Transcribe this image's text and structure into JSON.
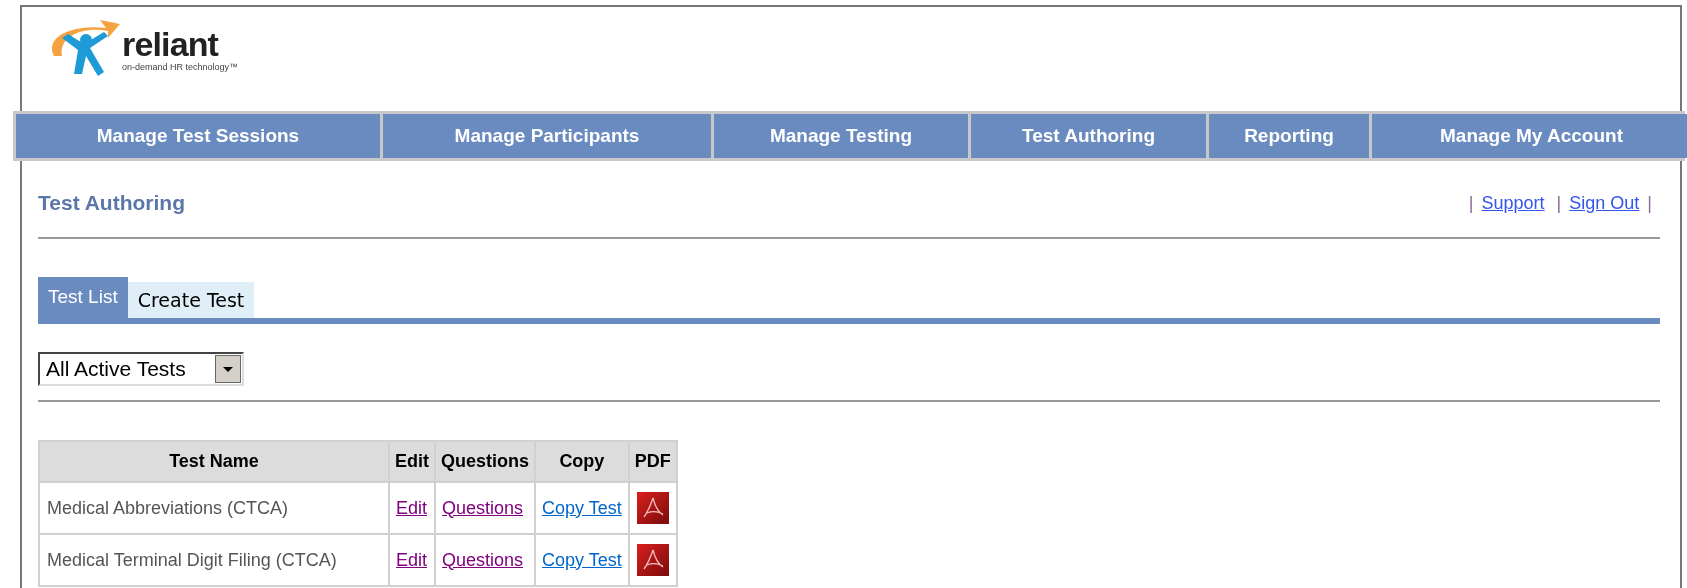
{
  "logo": {
    "name": "reliant",
    "tagline": "on-demand HR technology™"
  },
  "nav": [
    {
      "label": "Manage Test Sessions"
    },
    {
      "label": "Manage Participants"
    },
    {
      "label": "Manage Testing"
    },
    {
      "label": "Test Authoring"
    },
    {
      "label": "Reporting"
    },
    {
      "label": "Manage My Account"
    }
  ],
  "page_title": "Test Authoring",
  "header_links": {
    "separator": "|",
    "links": [
      "Support",
      "Sign Out"
    ]
  },
  "tabs": [
    {
      "label": "Test List",
      "selected": true
    },
    {
      "label": "Create Test",
      "selected": false
    }
  ],
  "filter": {
    "value": "All Active Tests"
  },
  "table": {
    "columns": [
      "Test Name",
      "Edit",
      "Questions",
      "Copy",
      "PDF"
    ],
    "rows": [
      {
        "name": "Medical Abbreviations (CTCA)",
        "edit": {
          "text": "Edit",
          "visited": true
        },
        "questions": {
          "text": "Questions",
          "visited": true
        },
        "copy": {
          "text": "Copy Test",
          "visited": false
        }
      },
      {
        "name": "Medical Terminal Digit Filing (CTCA)",
        "edit": {
          "text": "Edit",
          "visited": true
        },
        "questions": {
          "text": "Questions",
          "visited": true
        },
        "copy": {
          "text": "Copy Test",
          "visited": false
        }
      }
    ]
  }
}
